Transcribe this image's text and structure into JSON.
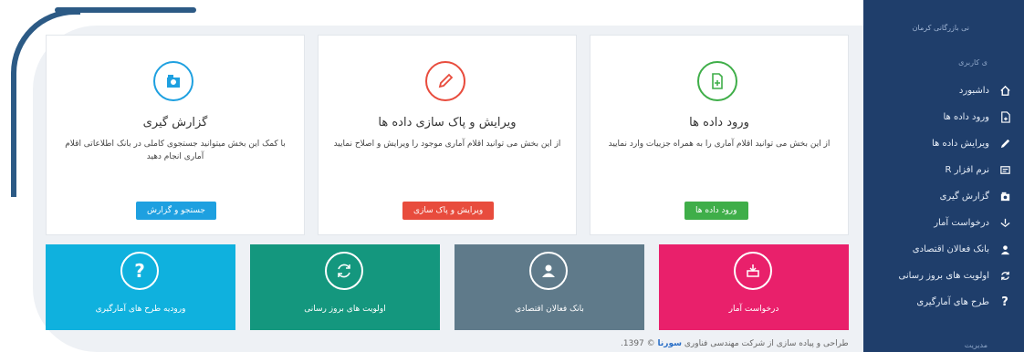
{
  "sidebar": {
    "org_text": "نی بازرگانی کرمان",
    "section_user": "ی کاربری",
    "section_admin": "مدیریت",
    "items": [
      {
        "label": "داشبورد",
        "icon": "home-icon"
      },
      {
        "label": "ورود داده ها",
        "icon": "file-add-icon"
      },
      {
        "label": "ویرایش داده ها",
        "icon": "pencil-icon"
      },
      {
        "label": "نرم افزار R",
        "icon": "software-icon"
      },
      {
        "label": "گزارش گیری",
        "icon": "report-icon"
      },
      {
        "label": "درخواست آمار",
        "icon": "inbox-icon"
      },
      {
        "label": "بانک فعالان اقتصادی",
        "icon": "users-icon"
      },
      {
        "label": "اولویت های بروز رسانی",
        "icon": "refresh-icon"
      },
      {
        "label": "طرح های آمارگیری",
        "icon": "question-icon"
      }
    ]
  },
  "cards": [
    {
      "title": "ورود داده ها",
      "desc": "از این بخش می توانید اقلام آماری را به همراه جزییات وارد نمایید",
      "button": "ورود داده ها",
      "color": "#3fae49",
      "icon": "file-add-icon"
    },
    {
      "title": "ویرایش و پاک سازی داده ها",
      "desc": "از این بخش می توانید اقلام آماری موجود را ویرایش و اصلاح نمایید",
      "button": "ویرایش و پاک سازی",
      "color": "#e84c3d",
      "icon": "pencil-icon"
    },
    {
      "title": "گزارش گیری",
      "desc": "با کمک این بخش میتوانید جستجوی کاملی در بانک اطلاعاتی اقلام آماری انجام دهید",
      "button": "جستجو و گزارش",
      "color": "#1ea0e0",
      "icon": "report-icon"
    }
  ],
  "tiles": [
    {
      "label": "درخواست آمار",
      "color": "#e9206b",
      "icon": "inbox-icon"
    },
    {
      "label": "بانک فعالان اقتصادی",
      "color": "#5f7a8a",
      "icon": "users-icon"
    },
    {
      "label": "اولویت های بروز رسانی",
      "color": "#14977e",
      "icon": "refresh-icon"
    },
    {
      "label": "ورودیه طرح های آمارگیری",
      "color": "#0fb1de",
      "icon": "question-icon"
    }
  ],
  "footer": {
    "prefix": "طراحی و پیاده سازی از شرکت مهندسی فناوری",
    "brand": "سورنا",
    "suffix": "© 1397."
  }
}
